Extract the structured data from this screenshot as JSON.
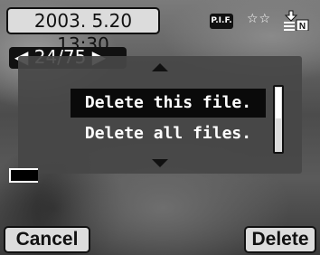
{
  "header": {
    "datetime": "2003. 5.20 13:30",
    "plf_badge": "P.I.F.",
    "stars": "☆☆",
    "print_icon": "print-icon"
  },
  "frame": {
    "counter": "24/75"
  },
  "dialog": {
    "options": [
      "Delete this file.",
      "Delete all files."
    ],
    "selected_index": 0
  },
  "softkeys": {
    "left": "Cancel",
    "right": "Delete"
  }
}
